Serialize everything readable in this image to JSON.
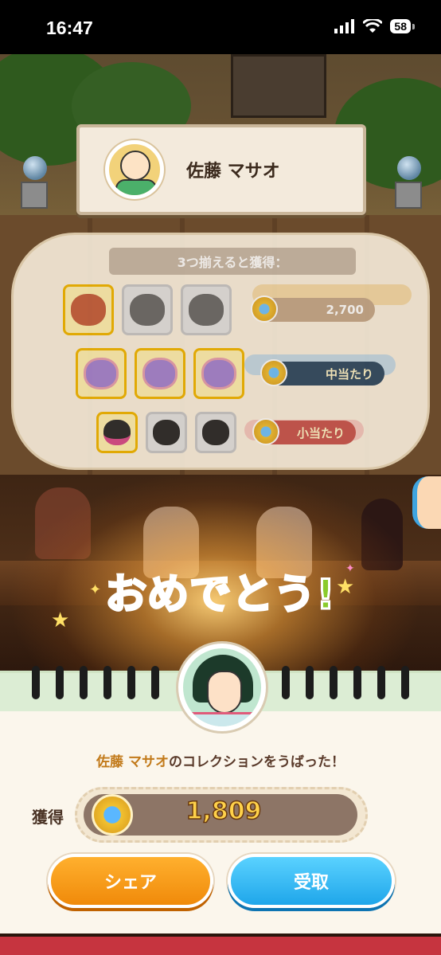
{
  "status_bar": {
    "time": "16:47",
    "battery": "58",
    "icons": [
      "signal-icon",
      "wifi-icon",
      "battery-icon"
    ]
  },
  "name_plate": {
    "name": "佐藤 マサオ"
  },
  "board": {
    "title": "3つ揃えると獲得：",
    "rows": [
      {
        "reward": "2,700",
        "tiles_collected": 1,
        "tiles_total": 3
      },
      {
        "reward": "中当たり",
        "tiles_collected": 3,
        "tiles_total": 3
      },
      {
        "reward": "小当たり",
        "tiles_collected": 1,
        "tiles_total": 3
      }
    ]
  },
  "congrats": {
    "parts": [
      "お",
      "め",
      "で",
      "と",
      "う",
      "!"
    ]
  },
  "panel": {
    "message_name": "佐藤 マサオ",
    "message_rest": "のコレクションをうばった！",
    "acquire_label": "獲得",
    "acquire_value": "1,809",
    "share_button": "シェア",
    "receive_button": "受取"
  },
  "colors": {
    "share": "#f08a0a",
    "receive": "#1fa6ea",
    "bottom_strip": "#c6343f",
    "coin_value": "#ffd24a"
  }
}
